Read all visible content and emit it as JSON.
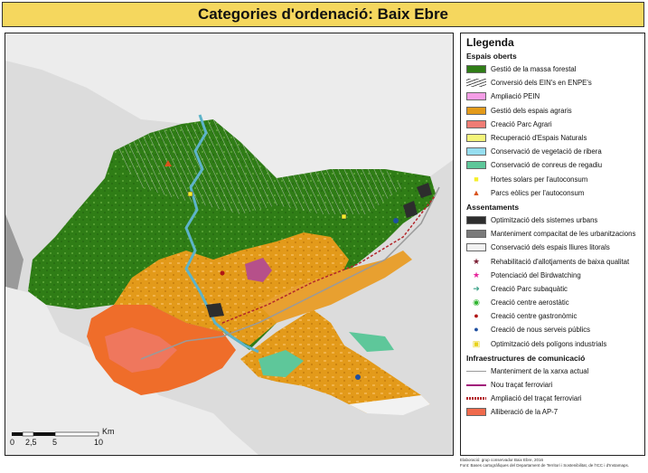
{
  "title": "Categories d'ordenació: Baix Ebre",
  "legend": {
    "heading": "Llegenda",
    "sections": [
      {
        "heading": "Espais oberts",
        "items": [
          {
            "label": "Gestió de la massa forestal",
            "color": "#2f7d16",
            "kind": "fill"
          },
          {
            "label": "Conversió dels EIN's en ENPE's",
            "color": "#555555",
            "kind": "hatch"
          },
          {
            "label": "Ampliació PEIN",
            "color": "#f59de6",
            "kind": "fill"
          },
          {
            "label": "Gestió dels espais agraris",
            "color": "#e39a1a",
            "kind": "fill"
          },
          {
            "label": "Creació Parc Agrari",
            "color": "#f07c74",
            "kind": "fill"
          },
          {
            "label": "Recuperació d'Espais Naturals",
            "color": "#f4f57a",
            "kind": "fill"
          },
          {
            "label": "Conservació de vegetació de ribera",
            "color": "#96def0",
            "kind": "fill"
          },
          {
            "label": "Conservació de conreus de regadiu",
            "color": "#5ec79a",
            "kind": "fill"
          },
          {
            "label": "Hortes solars per l'autoconsum",
            "color": "#f5ef2a",
            "kind": "square"
          },
          {
            "label": "Parcs eòlics per l'autoconsum",
            "color": "#d9541e",
            "kind": "triangle"
          }
        ]
      },
      {
        "heading": "Assentaments",
        "items": [
          {
            "label": "Optimització dels sistemes urbans",
            "color": "#2d2d2d",
            "kind": "fill"
          },
          {
            "label": "Manteniment compacitat de les urbanitzacions",
            "color": "#7a7a7a",
            "kind": "fill"
          },
          {
            "label": "Conservació dels espais lliures litorals",
            "color": "#f2f2f2",
            "kind": "fill"
          },
          {
            "label": "Rehabilitació d'allotjaments de baixa qualitat",
            "color": "#7a1d33",
            "kind": "star"
          },
          {
            "label": "Potenciació del Birdwatching",
            "color": "#e6229a",
            "kind": "star"
          },
          {
            "label": "Creació Parc subaquàtic",
            "color": "#3fa38a",
            "kind": "fish"
          },
          {
            "label": "Creació centre aerostàtic",
            "color": "#2fb52f",
            "kind": "circle-ring"
          },
          {
            "label": "Creació centre gastronòmic",
            "color": "#b01616",
            "kind": "circle"
          },
          {
            "label": "Creació de nous serveis públics",
            "color": "#1f4fa0",
            "kind": "circle"
          },
          {
            "label": "Optimització dels polígons industrials",
            "color": "#e8d21a",
            "kind": "square-dot"
          }
        ]
      },
      {
        "heading": "Infraestructures de comunicació",
        "items": [
          {
            "label": "Manteniment de la xarxa actual",
            "color": "#9a9a9a",
            "kind": "line"
          },
          {
            "label": "Nou traçat ferroviari",
            "color": "#a1157a",
            "kind": "line-thick"
          },
          {
            "label": "Ampliació del traçat ferroviari",
            "color": "#b3262b",
            "kind": "rail"
          },
          {
            "label": "Alliberació de la AP-7",
            "color": "#f06a4c",
            "kind": "fill"
          }
        ]
      }
    ]
  },
  "scale": {
    "unit": "Km",
    "ticks": [
      "0",
      "2,5",
      "5",
      "10"
    ]
  },
  "credits": [
    "Elaboració: grup conservador Baix Ebre, 2016",
    "Font: Bases cartogràfiques del Departament de Territori i Sostenibilitat, de l'ICC i d'Instamaps."
  ],
  "colors": {
    "title_bg": "#f5d75e",
    "sea": "#dcdcdc",
    "outside_land": "#ececec",
    "forest": "#2f7d16",
    "agrarian": "#e39a1a",
    "park": "#f07c74",
    "riparian": "#96def0",
    "irrigation": "#5ec79a",
    "urban": "#2d2d2d",
    "river": "#5db3c9"
  }
}
